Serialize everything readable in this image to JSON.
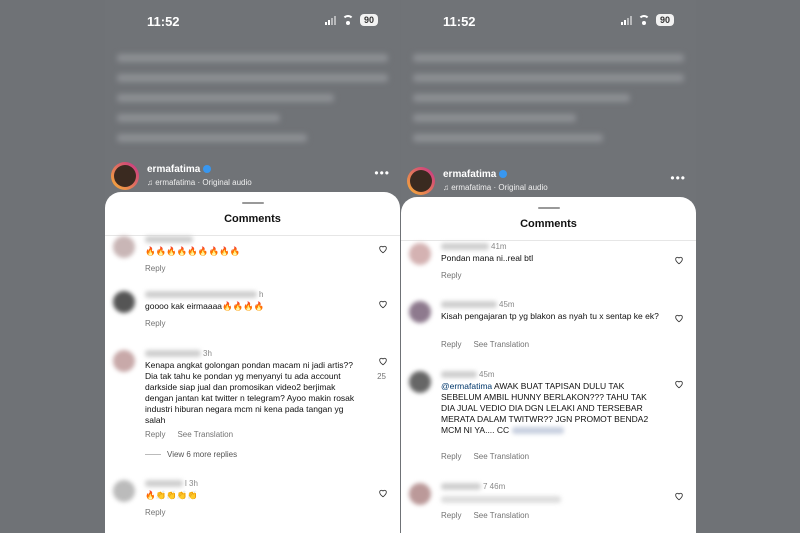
{
  "status": {
    "time": "11:52",
    "battery": "90"
  },
  "post": {
    "username": "ermafatima",
    "audio": "ermafatima · Original audio",
    "more": "•••"
  },
  "sheet": {
    "title": "Comments"
  },
  "labels": {
    "reply": "Reply",
    "see_translation": "See Translation"
  },
  "left": {
    "c1": {
      "time": "",
      "text": "🔥🔥🔥🔥🔥🔥🔥🔥🔥"
    },
    "c2": {
      "time": "h",
      "text": "goooo kak eirmaaaa🔥🔥🔥🔥"
    },
    "c3": {
      "time": "3h",
      "text": "Kenapa angkat golongan pondan macam ni jadi artis?? Dia tak tahu ke pondan yg menyanyi tu ada account darkside siap jual dan promosikan video2 berjimak dengan jantan kat twitter n telegram? Ayoo makin rosak industri hiburan negara mcm ni kena pada tangan yg salah",
      "likes": "25",
      "view_more": "View 6 more replies"
    },
    "c4": {
      "time": "l 3h",
      "text": "🔥👏👏👏👏"
    }
  },
  "right": {
    "c1": {
      "time": "41m",
      "text": "Pondan mana ni..real btl"
    },
    "c2": {
      "time": "45m",
      "text": "Kisah pengajaran tp yg blakon as nyah tu x sentap ke ek?"
    },
    "c3": {
      "time": "45m",
      "mention": "@ermafatima",
      "text": " AWAK BUAT TAPISAN DULU TAK SEBELUM AMBIL HUNNY BERLAKON??? TAHU TAK DIA JUAL VEDIO DIA DGN LELAKI AND TERSEBAR MERATA DALAM TWITWR?? JGN PROMOT BENDA2 MCM NI YA.... CC "
    },
    "c4": {
      "time": "7 46m",
      "text": ""
    }
  }
}
